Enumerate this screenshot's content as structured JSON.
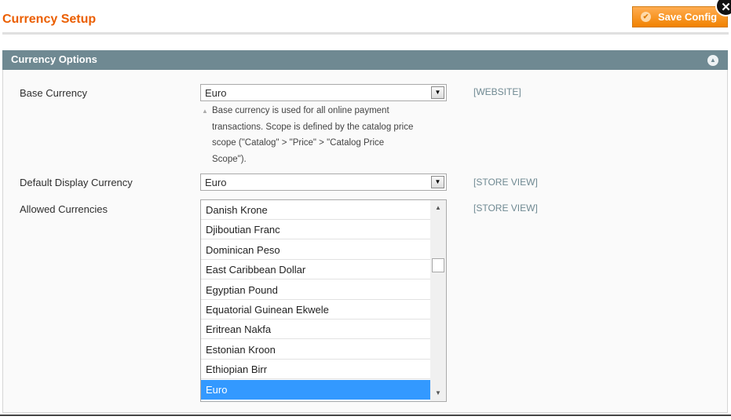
{
  "header": {
    "title": "Currency Setup",
    "save_label": "Save Config",
    "save_icon": "check-circle-icon",
    "close_icon": "close-icon"
  },
  "section": {
    "title": "Currency Options",
    "collapse_icon": "chevron-up-icon"
  },
  "base_currency": {
    "label": "Base Currency",
    "value": "Euro",
    "scope": "[WEBSITE]",
    "hint_lines": [
      "Base currency is used for all online payment",
      "transactions. Scope is defined by the catalog price",
      "scope (\"Catalog\" > \"Price\" > \"Catalog Price",
      "Scope\")."
    ]
  },
  "default_display_currency": {
    "label": "Default Display Currency",
    "value": "Euro",
    "scope": "[STORE VIEW]"
  },
  "allowed_currencies": {
    "label": "Allowed Currencies",
    "scope": "[STORE VIEW]",
    "options": [
      "Danish Krone",
      "Djiboutian Franc",
      "Dominican Peso",
      "East Caribbean Dollar",
      "Egyptian Pound",
      "Equatorial Guinean Ekwele",
      "Eritrean Nakfa",
      "Estonian Kroon",
      "Ethiopian Birr",
      "Euro"
    ],
    "selected": "Euro"
  },
  "colors": {
    "title": "#eb5e00",
    "button": "#f18200",
    "section_header": "#6f8992",
    "selected_option": "#3399ff"
  }
}
